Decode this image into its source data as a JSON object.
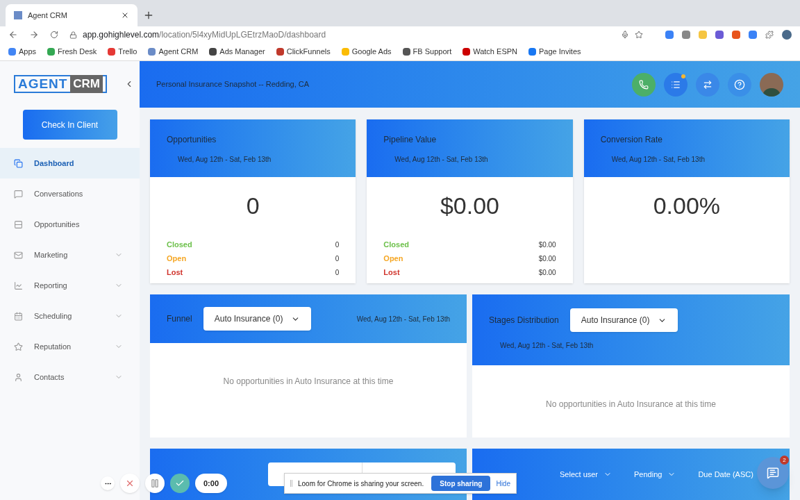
{
  "browser": {
    "tab_title": "Agent CRM",
    "url_host": "app.gohighlevel.com",
    "url_path": "/location/5l4xyMidUpLGEtrzMaoD/dashboard",
    "bookmarks": [
      {
        "label": "Apps",
        "color": "#4285f4"
      },
      {
        "label": "Fresh Desk",
        "color": "#34a853"
      },
      {
        "label": "Trello",
        "color": "#e53935"
      },
      {
        "label": "Agent CRM",
        "color": "#6b8cc7"
      },
      {
        "label": "Ads Manager",
        "color": "#444444"
      },
      {
        "label": "ClickFunnels",
        "color": "#c0392b"
      },
      {
        "label": "Google Ads",
        "color": "#fbbc04"
      },
      {
        "label": "FB Support",
        "color": "#555555"
      },
      {
        "label": "Watch ESPN",
        "color": "#cc0000"
      },
      {
        "label": "Page Invites",
        "color": "#1877f2"
      }
    ]
  },
  "sidebar": {
    "logo_left": "AGENT",
    "logo_right": "CRM",
    "check_in_button": "Check In Client",
    "items": [
      {
        "label": "Dashboard",
        "selected": true,
        "expandable": false
      },
      {
        "label": "Conversations",
        "selected": false,
        "expandable": false
      },
      {
        "label": "Opportunities",
        "selected": false,
        "expandable": false
      },
      {
        "label": "Marketing",
        "selected": false,
        "expandable": true
      },
      {
        "label": "Reporting",
        "selected": false,
        "expandable": true
      },
      {
        "label": "Scheduling",
        "selected": false,
        "expandable": true
      },
      {
        "label": "Reputation",
        "selected": false,
        "expandable": true
      },
      {
        "label": "Contacts",
        "selected": false,
        "expandable": true
      }
    ]
  },
  "header": {
    "location": "Personal Insurance Snapshot -- Redding, CA",
    "task_notification": true
  },
  "stat_cards": [
    {
      "title": "Opportunities",
      "date_range": "Wed, Aug 12th - Sat, Feb 13th",
      "value": "0",
      "breakdown": [
        {
          "label": "Closed",
          "value": "0",
          "color": "#6cc04a"
        },
        {
          "label": "Open",
          "value": "0",
          "color": "#f5a623"
        },
        {
          "label": "Lost",
          "value": "0",
          "color": "#d0342c"
        }
      ]
    },
    {
      "title": "Pipeline Value",
      "date_range": "Wed, Aug 12th - Sat, Feb 13th",
      "value": "$0.00",
      "breakdown": [
        {
          "label": "Closed",
          "value": "$0.00",
          "color": "#6cc04a"
        },
        {
          "label": "Open",
          "value": "$0.00",
          "color": "#f5a623"
        },
        {
          "label": "Lost",
          "value": "$0.00",
          "color": "#d0342c"
        }
      ]
    },
    {
      "title": "Conversion Rate",
      "date_range": "Wed, Aug 12th - Sat, Feb 13th",
      "value": "0.00%"
    }
  ],
  "funnel": {
    "title": "Funnel",
    "dropdown": "Auto Insurance (0)",
    "date_range": "Wed, Aug 12th - Sat, Feb 13th",
    "empty_message": "No opportunities in Auto Insurance at this time"
  },
  "stages": {
    "title": "Stages Distribution",
    "dropdown": "Auto Insurance (0)",
    "date_range": "Wed, Aug 12th - Sat, Feb 13th",
    "empty_message": "No opportunities in Auto Insurance at this time"
  },
  "tasks": {
    "filters": [
      "Select user",
      "Pending",
      "Due Date (ASC)"
    ]
  },
  "chat": {
    "badge": "2"
  },
  "loom": {
    "message": "Loom for Chrome is sharing your screen.",
    "stop_button": "Stop sharing",
    "hide_link": "Hide",
    "timer": "0:00"
  }
}
